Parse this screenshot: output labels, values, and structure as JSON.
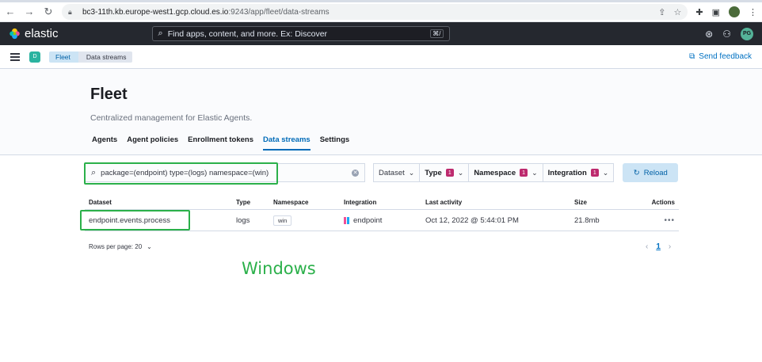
{
  "browser": {
    "url_host": "bc3-11th.kb.europe-west1.gcp.cloud.es.io",
    "url_path": ":9243/app/fleet/data-streams"
  },
  "header": {
    "brand": "elastic",
    "search_placeholder": "Find apps, content, and more. Ex: Discover",
    "search_shortcut": "⌘/",
    "avatar_initials": "PG"
  },
  "subheader": {
    "space_initial": "D",
    "breadcrumbs": [
      "Fleet",
      "Data streams"
    ],
    "feedback": "Send feedback"
  },
  "page": {
    "title": "Fleet",
    "description": "Centralized management for Elastic Agents.",
    "tabs": [
      "Agents",
      "Agent policies",
      "Enrollment tokens",
      "Data streams",
      "Settings"
    ]
  },
  "toolbar": {
    "query": "package=(endpoint) type=(logs) namespace=(win)",
    "filters": [
      {
        "label": "Dataset",
        "count": ""
      },
      {
        "label": "Type",
        "count": "1"
      },
      {
        "label": "Namespace",
        "count": "1"
      },
      {
        "label": "Integration",
        "count": "1"
      }
    ],
    "reload": "Reload"
  },
  "table": {
    "columns": [
      "Dataset",
      "Type",
      "Namespace",
      "Integration",
      "Last activity",
      "Size",
      "Actions"
    ],
    "rows": [
      {
        "dataset": "endpoint.events.process",
        "type": "logs",
        "namespace": "win",
        "integration": "endpoint",
        "last_activity": "Oct 12, 2022 @ 5:44:01 PM",
        "size": "21.8mb",
        "actions": "•••"
      }
    ]
  },
  "pagination": {
    "rows_per_page": "Rows per page: 20",
    "current_page": "1"
  },
  "annotation": "Windows",
  "colors": {
    "accent": "#006bb8",
    "highlight": "#2bb04a",
    "badge": "#bd2a6e"
  }
}
